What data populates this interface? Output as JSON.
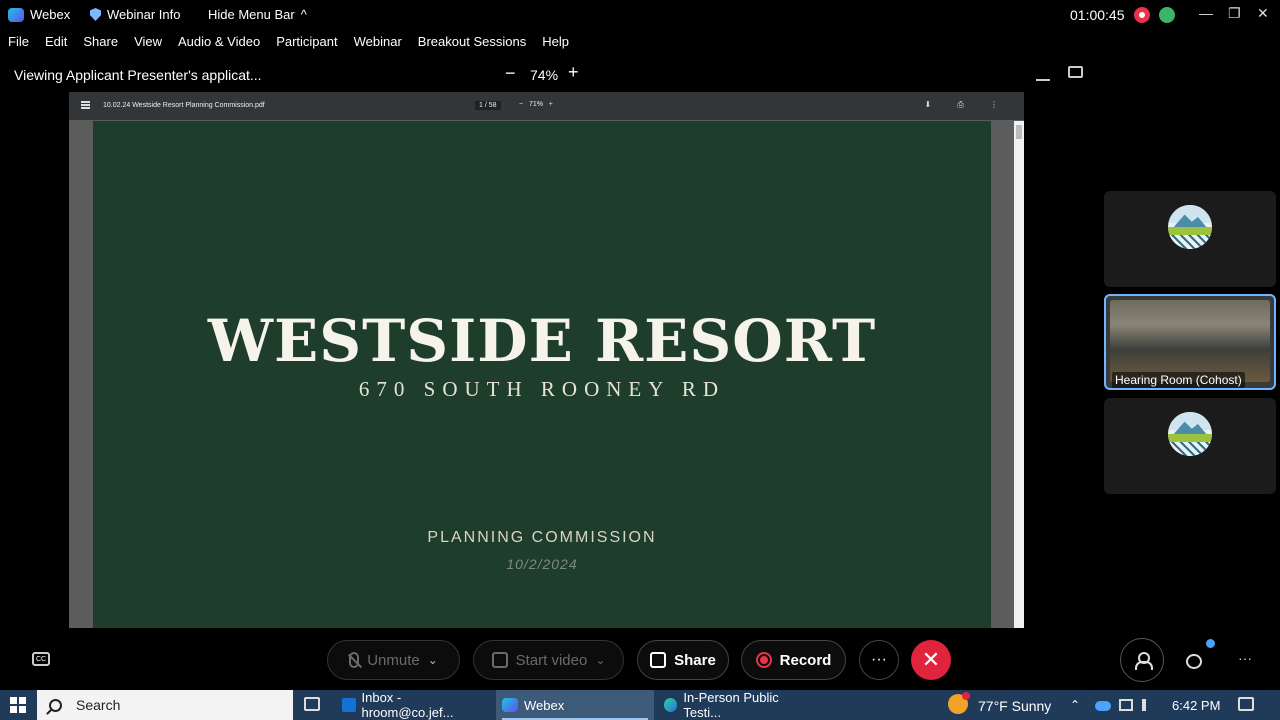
{
  "titlebar": {
    "app_name": "Webex",
    "webinar_info": "Webinar Info",
    "hide_menu": "Hide Menu Bar",
    "hide_menu_chevron": "^",
    "timer": "01:00:45",
    "minimize": "—",
    "restore": "❐",
    "close": "✕"
  },
  "menu": {
    "items": [
      "File",
      "Edit",
      "Share",
      "View",
      "Audio & Video",
      "Participant",
      "Webinar",
      "Breakout Sessions",
      "Help"
    ]
  },
  "viewing": {
    "label": "Viewing Applicant Presenter's applicat...",
    "zoom": "74%",
    "minus": "−",
    "plus": "+"
  },
  "pdf": {
    "filename": "10.02.24 Westside Resort Planning Commission.pdf",
    "page": "1",
    "total": "/ 58",
    "zoom": "71%",
    "zoom_minus": "−",
    "zoom_plus": "+",
    "right_icons": "⬇ ⎙ ⋮"
  },
  "slide": {
    "title": "WESTSIDE RESORT",
    "address": "670 SOUTH ROONEY RD",
    "subtitle": "PLANNING COMMISSION",
    "date": "10/2/2024",
    "bg_color": "#1e3d2b"
  },
  "participants": {
    "room_label": "Hearing Room (Cohost)"
  },
  "controls": {
    "unmute": "Unmute",
    "start_video": "Start video",
    "share": "Share",
    "record": "Record",
    "more": "···",
    "end": "✕",
    "chevron": "⌄",
    "cc": "CC",
    "dots": "···"
  },
  "taskbar": {
    "search": "Search",
    "apps": [
      {
        "label": "Inbox - hroom@co.jef...",
        "icon": "outlook-icon"
      },
      {
        "label": "Webex",
        "icon": "webex-icon"
      },
      {
        "label": "In-Person Public Testi...",
        "icon": "edge-icon"
      }
    ],
    "weather": "77°F  Sunny",
    "tray_chevron": "⌃",
    "time": "6:42 PM"
  },
  "colors": {
    "accent_red": "#e0243d",
    "slide_green": "#1e3d2b",
    "taskbar": "#1f3b59"
  }
}
